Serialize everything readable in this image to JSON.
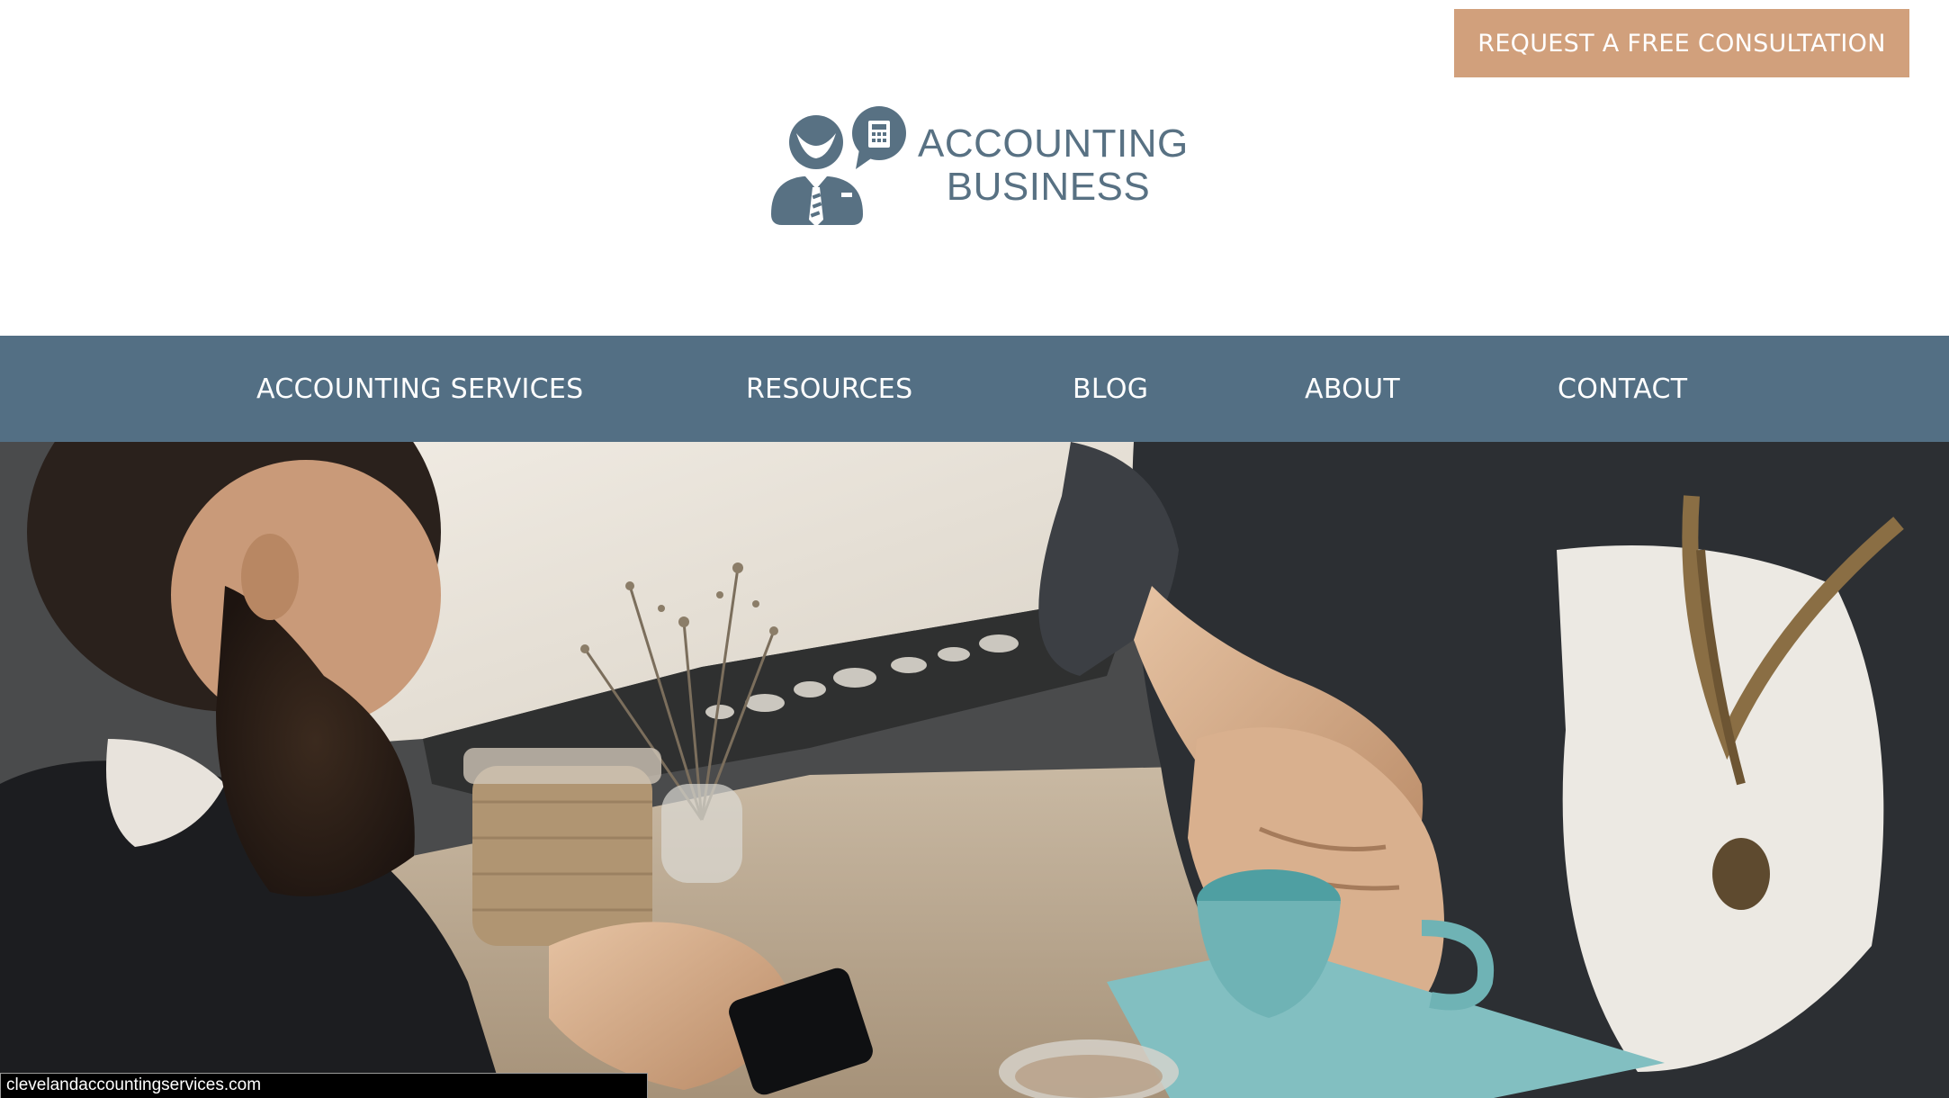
{
  "header": {
    "cta_label": "REQUEST A FREE CONSULTATION",
    "logo": {
      "line1": "ACCOUNTING",
      "line2": "BUSINESS",
      "icon": "accountant-with-calculator-icon"
    }
  },
  "nav": {
    "items": [
      {
        "label": "ACCOUNTING SERVICES"
      },
      {
        "label": "RESOURCES"
      },
      {
        "label": "BLOG"
      },
      {
        "label": "ABOUT"
      },
      {
        "label": "CONTACT"
      }
    ]
  },
  "hero": {
    "image": "business-handshake-photo"
  },
  "status_bar": {
    "url": "clevelandaccountingservices.com"
  },
  "colors": {
    "cta_background": "#d1a07c",
    "nav_background": "#536f84",
    "logo_color": "#587183"
  }
}
